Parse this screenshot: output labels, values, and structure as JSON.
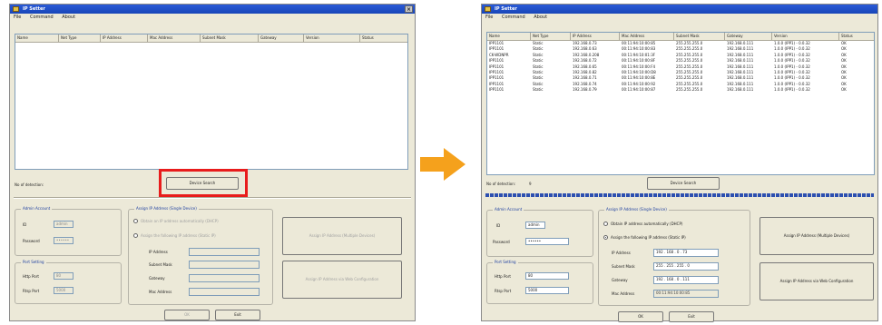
{
  "colors": {
    "title_bar": "#1846b8",
    "highlight": "#e81c1c",
    "arrow": "#f5a11c",
    "progress": "#2c4fb0"
  },
  "left_window": {
    "title": "IP Setter",
    "menu": [
      "File",
      "Command",
      "About"
    ],
    "columns": [
      "Name",
      "Net Type",
      "IP Address",
      "Mac Address",
      "Subnet Mask",
      "Gateway",
      "Version",
      "Status"
    ],
    "num_label": "No of detection:",
    "search_button": "Device Search",
    "admin_group": "Admin Account",
    "id_label": "ID",
    "id_value": "admin",
    "password_label": "Password",
    "password_value": "••••••",
    "assign_group": "Assign IP Address (Single Device)",
    "radio_dhcp": "Obtain an IP address automatically (DHCP)",
    "radio_static": "Assign the following IP address (Static IP)",
    "ip_label": "IP Address",
    "subnet_label": "Subnet Mask",
    "gateway_label": "Gateway",
    "mac_label": "Mac Address",
    "port_group": "Port Setting",
    "http_label": "Http Port",
    "http_value": "80",
    "rtsp_label": "Rtsp Port",
    "rtsp_value": "5000",
    "assign_multi_button": "Assign IP Address (Multiple Devices)",
    "assign_web_button": "Assign IP Address via Web Configuration",
    "ok_button": "OK",
    "exit_button": "Exit"
  },
  "right_window": {
    "title": "IP Setter",
    "menu": [
      "File",
      "Command",
      "About"
    ],
    "columns": [
      "Name",
      "Net Type",
      "IP Address",
      "Mac Address",
      "Subnet Mask",
      "Gateway",
      "Version",
      "Status"
    ],
    "rows": [
      [
        "IPP1101",
        "Static",
        "192.168.0.73",
        "00:11:94:10:00:85",
        "255.255.255.0",
        "192.168.0.111",
        "1.0.0 (IPP1) - 0.0.32",
        "OK"
      ],
      [
        "IPP1101",
        "Static",
        "192.168.0.63",
        "00:11:94:10:00:83",
        "255.255.255.0",
        "192.168.0.111",
        "1.0.0 (IPP1) - 0.0.32",
        "OK"
      ],
      [
        "CK-WDNPR",
        "Static",
        "192.168.0.208",
        "00:11:94:10:01:3F",
        "255.255.255.0",
        "192.168.0.111",
        "1.0.0 (IPP1) - 0.0.32",
        "OK"
      ],
      [
        "IPP1101",
        "Static",
        "192.168.0.72",
        "00:11:94:10:00:8F",
        "255.255.255.0",
        "192.168.0.111",
        "1.0.0 (IPP1) - 0.0.32",
        "OK"
      ],
      [
        "IPP1101",
        "Static",
        "192.168.0.65",
        "00:11:94:10:00:F4",
        "255.255.255.0",
        "192.168.0.111",
        "1.0.0 (IPP1) - 0.0.32",
        "OK"
      ],
      [
        "IPP1101",
        "Static",
        "192.168.0.82",
        "00:11:94:10:00:D8",
        "255.255.255.0",
        "192.168.0.111",
        "1.0.0 (IPP1) - 0.0.32",
        "OK"
      ],
      [
        "IPP1101",
        "Static",
        "192.168.0.71",
        "00:11:94:10:00:8E",
        "255.255.255.0",
        "192.168.0.111",
        "1.0.0 (IPP1) - 0.0.32",
        "OK"
      ],
      [
        "IPP1101",
        "Static",
        "192.168.0.74",
        "00:11:94:10:00:92",
        "255.255.255.0",
        "192.168.0.111",
        "1.0.0 (IPP1) - 0.0.32",
        "OK"
      ],
      [
        "IPP1101",
        "Static",
        "192.168.0.79",
        "00:11:94:10:00:87",
        "255.255.255.0",
        "192.168.0.111",
        "1.0.0 (IPP1) - 0.0.32",
        "OK"
      ]
    ],
    "num_label": "No of detection:",
    "num_value": "9",
    "search_button": "Device Search",
    "progress_fraction": 1.0,
    "admin_group": "Admin Account",
    "id_label": "ID",
    "id_value": "admin",
    "password_label": "Password",
    "password_value": "••••••",
    "assign_group": "Assign IP Address (Single Device)",
    "radio_dhcp": "Obtain IP address automatically (DHCP)",
    "radio_static": "Assign the following IP address (Static IP)",
    "ip_label": "IP Address",
    "ip_value": "192 . 168 . 0 . 73",
    "subnet_label": "Subnet Mask",
    "subnet_value": "255 . 255 . 255 . 0",
    "gateway_label": "Gateway",
    "gateway_value": "192 . 168 . 0 . 111",
    "mac_label": "Mac Address",
    "mac_value": "00:11:94:10:00:85",
    "port_group": "Port Setting",
    "http_label": "Http Port",
    "http_value": "80",
    "rtsp_label": "Rtsp Port",
    "rtsp_value": "5000",
    "assign_multi_button": "Assign IP Address (Multiple Devices)",
    "assign_web_button": "Assign IP Address via Web Configuration",
    "ok_button": "OK",
    "exit_button": "Exit"
  }
}
